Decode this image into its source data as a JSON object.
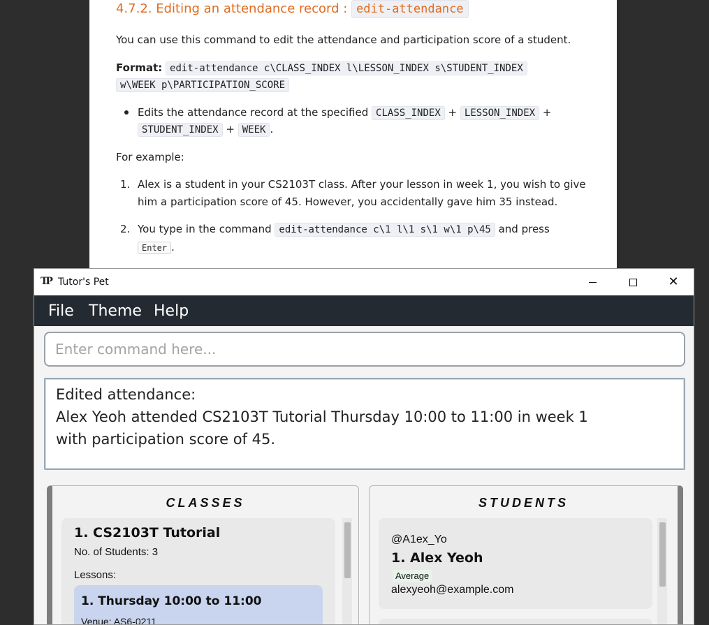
{
  "doc": {
    "heading_text": "4.7.2. Editing an attendance record : ",
    "heading_code": "edit-attendance",
    "intro": "You can use this command to edit the attendance and participation score of a student.",
    "format_label": "Format:",
    "format_code_line1": "edit-attendance c\\CLASS_INDEX l\\LESSON_INDEX s\\STUDENT_INDEX",
    "format_code_line2": "w\\WEEK p\\PARTICIPATION_SCORE",
    "bullet_text": "Edits the attendance record at the specified",
    "bullet_codes": [
      "CLASS_INDEX",
      "LESSON_INDEX",
      "STUDENT_INDEX",
      "WEEK"
    ],
    "plus": "+",
    "period": ".",
    "example_label": "For example:",
    "item1_num": "1.",
    "item1_line1": "Alex is a student in your CS2103T class. After your lesson in week 1, you wish to give",
    "item1_line2": "him a participation score of 45. However, you accidentally gave him 35 instead.",
    "item2_num": "2.",
    "item2_pre": "You type in the command",
    "item2_code": "edit-attendance c\\1 l\\1 s\\1 w\\1 p\\45",
    "item2_post": "and press",
    "item2_key": "Enter"
  },
  "window": {
    "title": "Tutor's Pet",
    "icon_text": "TP"
  },
  "menu": [
    "File",
    "Theme",
    "Help"
  ],
  "command": {
    "placeholder": "Enter command here..."
  },
  "result": {
    "line1": "Edited attendance:",
    "line2": "Alex Yeoh attended CS2103T Tutorial Thursday 10:00 to 11:00 in week 1",
    "line3": "with participation score of 45."
  },
  "classes_panel": {
    "title": "CLASSES",
    "class_title": "1.  CS2103T Tutorial",
    "students_label": "No. of Students:  3",
    "lessons_label": "Lessons:",
    "lesson_title": "1. Thursday 10:00 to 11:00",
    "lesson_venue": "Venue: AS6-0211"
  },
  "students_panel": {
    "title": "STUDENTS",
    "telegram": "@A1ex_Yo",
    "name": "1.  Alex Yeoh",
    "badge": "Average",
    "email": "alexyeoh@example.com"
  }
}
